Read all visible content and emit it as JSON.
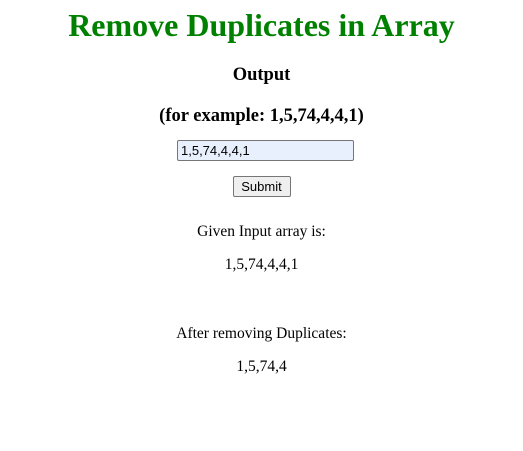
{
  "page": {
    "title": "Remove Duplicates in Array",
    "output_heading": "Output",
    "example_hint": "(for example: 1,5,74,4,4,1)"
  },
  "form": {
    "input_value": "1,5,74,4,4,1",
    "submit_label": "Submit"
  },
  "result": {
    "given_label": "Given Input array is:",
    "given_value": "1,5,74,4,4,1",
    "after_label": "After removing Duplicates:",
    "after_value": "1,5,74,4"
  },
  "colors": {
    "title": "#008000",
    "input_bg": "#e8f0fe"
  }
}
